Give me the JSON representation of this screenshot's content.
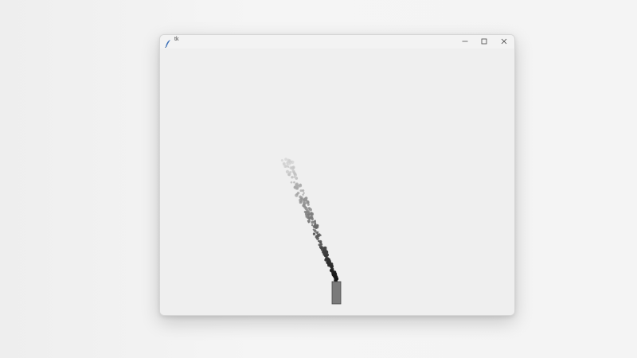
{
  "window": {
    "title": "tk",
    "minimize_icon": "minimize-icon",
    "maximize_icon": "maximize-icon",
    "close_icon": "close-icon",
    "app_icon": "feather-icon"
  },
  "scene": {
    "emitter_color": "#7a7a7a",
    "emitter_border": "#4a4a4a",
    "particle_color_near": "#111111",
    "particle_color_far": "#cfcfcf"
  }
}
